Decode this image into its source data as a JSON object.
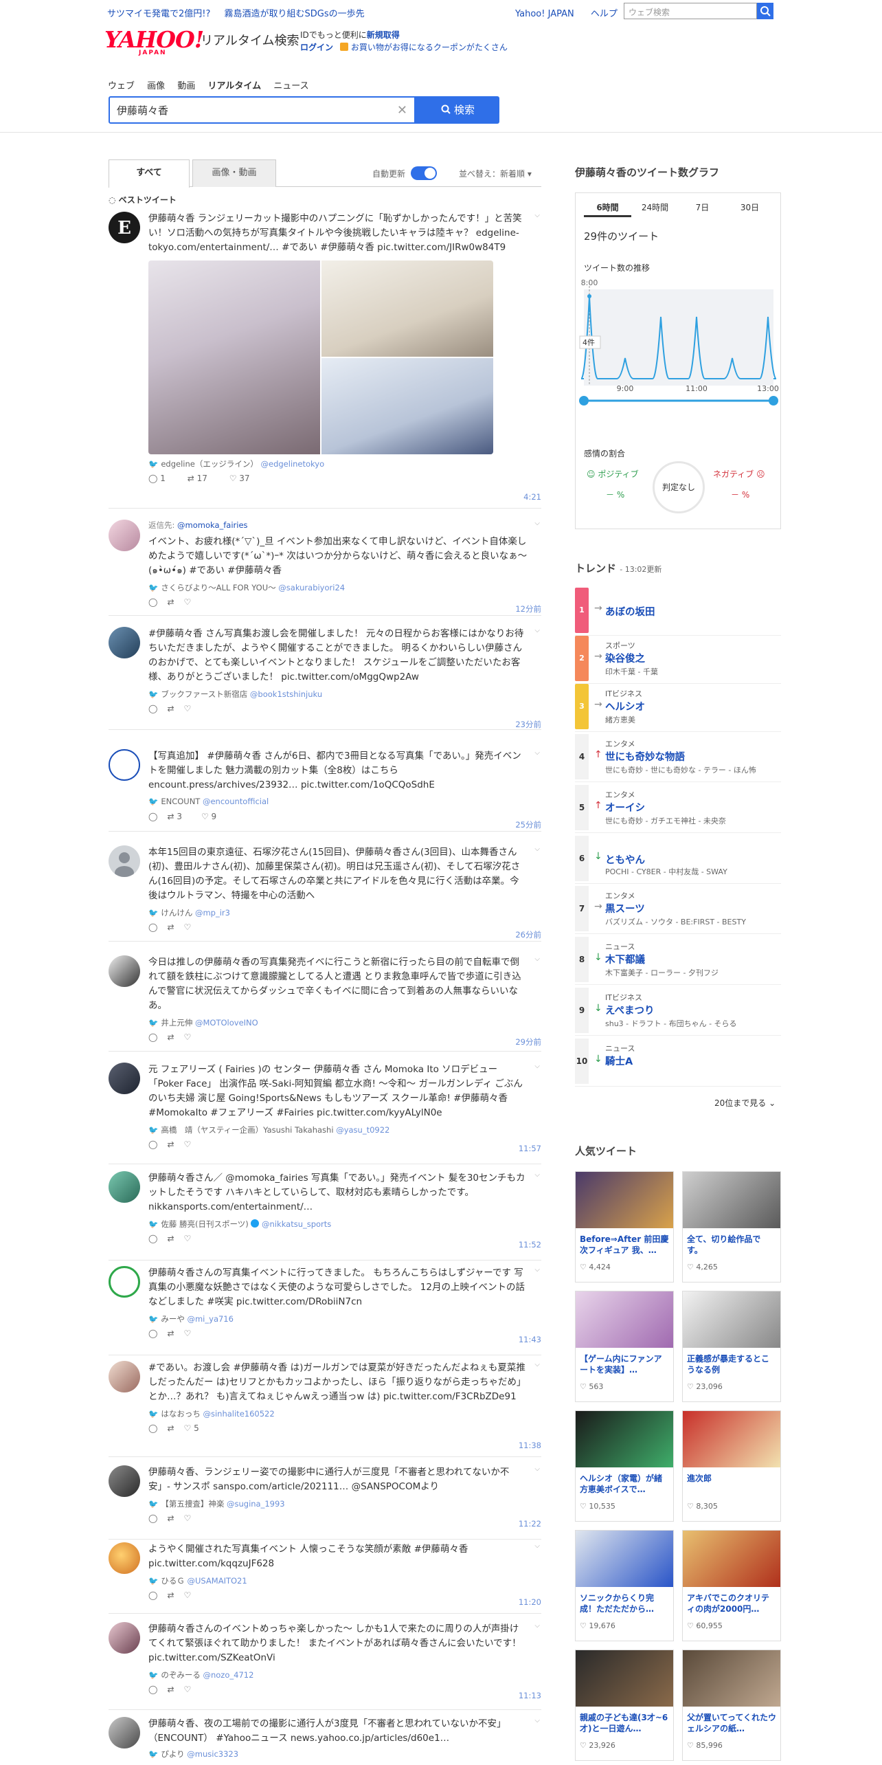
{
  "topstrip": {
    "news": [
      "サツマイモ発電で2億円!?",
      "霧島酒造が取り組むSDGsの一歩先"
    ],
    "links": [
      "Yahoo! JAPAN",
      "ヘルプ"
    ],
    "search_placeholder": "ウェブ検索"
  },
  "header": {
    "logo_text": "YAHOO!",
    "logo_sub": "JAPAN",
    "service": "リアルタイム検索",
    "id_line1a": "IDでもっと便利に",
    "id_line1b": "新規取得",
    "id_line2a": "ログイン",
    "id_line2b": "お買い物がお得になるクーポンがたくさん"
  },
  "nav": [
    "ウェブ",
    "画像",
    "動画",
    "リアルタイム",
    "ニュース"
  ],
  "search": {
    "query": "伊藤萌々香",
    "button": "検索"
  },
  "tabs": {
    "all": "すべて",
    "media": "画像・動画",
    "auto": "自動更新",
    "sort": "並べ替え：新着順"
  },
  "best_header": "ベストツイート",
  "tweets": [
    {
      "text": "伊藤萌々香 ランジェリーカット撮影中のハプニングに「恥ずかしかったんです！」と苦笑い！ソロ活動への気持ちが写真集タイトルや今後挑戦したいキャラは陸キャ？ edgeline-tokyo.com/entertainment/… #であい #伊藤萌々香 pic.twitter.com/JIRw0w84T9",
      "user": "edgeline（エッジライン）",
      "handle": "@edgelinetokyo",
      "reply_count": "1",
      "rt_count": "17",
      "like_count": "37",
      "time": "4:21"
    },
    {
      "reply_to": "@momoka_fairies",
      "text": "イベント、お疲れ様(*´▽`)_旦 イベント参加出来なくて申し訳ないけど、イベント自体楽しめたようで嬉しいです(*´ω`*)ｰ* 次はいつか分からないけど、萌々香に会えると良いなぁ～(๑•̀ω•́๑) #であい #伊藤萌々香",
      "user": "さくらびより～ALL FOR YOU～",
      "handle": "@sakurabiyori24",
      "time": "12分前"
    },
    {
      "text": "#伊藤萌々香 さん写真集お渡し会を開催しました！ 元々の日程からお客様にはかなりお待ちいただきましたが、ようやく開催することができました。 明るくかわいらしい伊藤さんのおかげで、とても楽しいイベントとなりました！ スケジュールをご調整いただいたお客様、ありがとうございました！ pic.twitter.com/oMggQwp2Aw",
      "user": "ブックファースト新宿店",
      "handle": "@book1stshinjuku",
      "time": "23分前"
    },
    {
      "text": "【写真追加】 #伊藤萌々香 さんが6日、都内で3冊目となる写真集「であい。」発売イベントを開催しました 魅力満載の別カット集（全8枚）はこちら encount.press/archives/23932… pic.twitter.com/1oQCQoSdhE",
      "user": "ENCOUNT",
      "handle": "@encountofficial",
      "rt_count": "3",
      "like_count": "9",
      "time": "25分前"
    },
    {
      "text": "本年15回目の東京遠征、石塚汐花さん(15回目)、伊藤萌々香さん(3回目)、山本舞香さん(初)、豊田ルナさん(初)、加藤里保菜さん(初)。明日は兄玉遥さん(初)、そして石塚汐花さん(16回目)の予定。そして石塚さんの卒業と共にアイドルを色々見に行く活動は卒業。今後はウルトラマン、特撮を中心の活動へ",
      "user": "けんけん",
      "handle": "@mp_ir3",
      "time": "26分前"
    },
    {
      "text": "今日は推しの伊藤萌々香の写真集発売イベに行こうと新宿に行ったら目の前で自転車で倒れて額を鉄柱にぶつけて意識朦朧としてる人と遭遇 とりま救急車呼んで皆で歩道に引き込んで警官に状況伝えてからダッシュで辛くもイベに間に合って到着あの人無事ならいいなあ。",
      "user": "井上元伸",
      "handle": "@MOTOloveINO",
      "time": "29分前"
    },
    {
      "text": "元 フェアリーズ ( Fairies )の センター 伊藤萌々香 さん Momoka Ito ソロデビュー「Poker Face」 出演作品 咲-Saki-阿知賀編 都立水商! ～令和～ ガールガンレディ ごぶんのいち夫婦 演じ屋 Going!Sports&News もしもツアーズ スクール革命! #伊藤萌々香 #MomokaIto #フェアリーズ #Fairies pic.twitter.com/kyyALylN0e",
      "user": "高橋　靖（ヤスティー企画）Yasushi Takahashi",
      "handle": "@yasu_t0922",
      "time": "11:57"
    },
    {
      "text": "伊藤萌々香さん／ @momoka_fairies 写真集「であい。」発売イベント 髪を30センチもカットしたそうです ハキハキとしていらして、取材対応も素晴らしかったです。 nikkansports.com/entertainment/…",
      "user": "佐藤 勝亮(日刊スポーツ)",
      "handle": "@nikkatsu_sports",
      "time": "11:52"
    },
    {
      "text": "伊藤萌々香さんの写真集イベントに行ってきました。 もちろんこちらはしずジャーです 写真集の小悪魔な妖艶さではなく天使のような可愛らしさでした。 12月の上映イベントの話などしました #咲実 pic.twitter.com/DRobiiN7cn",
      "user": "みーや",
      "handle": "@mi_ya716",
      "time": "11:43"
    },
    {
      "text": "#であい。お渡し会 #伊藤萌々香 は)ガールガンでは夏菜が好きだったんだよねぇも夏菜推しだったんだー は)セリフとかもカッコよかったし、ほら「振り返りながら走っちゃだめ」とか…？あれ？ も)言えてねぇじゃんwえっ通当っw は) pic.twitter.com/F3CRbZDe91",
      "user": "はなおっち",
      "handle": "@sinhalite160522",
      "like_count": "5",
      "time": "11:38"
    },
    {
      "text": "伊藤萌々香、ランジェリー姿での撮影中に通行人が三度見「不審者と思われてないか不安」- サンスポ sanspo.com/article/202111… @SANSPOCOMより",
      "user": "【第五捜査】神楽",
      "handle": "@sugina_1993",
      "time": "11:22"
    },
    {
      "text": "ようやく開催された写真集イベント 人懐っこそうな笑顔が素敵 #伊藤萌々香 pic.twitter.com/kqqzuJF628",
      "user": "ひるＧ",
      "handle": "@USAMAITO21",
      "time": "11:20"
    },
    {
      "text": "伊藤萌々香さんのイベントめっちゃ楽しかった〜 しかも1人で来たのに周りの人が声掛けてくれて緊張ほぐれて助かりました！ またイベントがあれば萌々香さんに会いたいです！ pic.twitter.com/SZKeatOnVi",
      "user": "のぞみーる",
      "handle": "@nozo_4712",
      "time": "11:13"
    },
    {
      "text": "伊藤萌々香、夜の工場前での撮影に通行人が3度見「不審者と思われていないか不安」（ENCOUNT） #Yahooニュース news.yahoo.co.jp/articles/d60e1…",
      "user": "ぴより",
      "handle": "@music3323",
      "time": ""
    }
  ],
  "graph": {
    "title": "伊藤萌々香のツイート数グラフ",
    "ranges": [
      "6時間",
      "24時間",
      "7日",
      "30日"
    ],
    "count": "29件のツイート",
    "trend_label": "ツイート数の推移",
    "peak_time": "8:00",
    "peak_value": "4件",
    "x_ticks": [
      "9:00",
      "11:00",
      "13:00"
    ],
    "sentiment_label": "感情の割合",
    "positive": "ポジティブ",
    "negative": "ネガティブ",
    "pos_pct": "－ %",
    "neg_pct": "－ %",
    "judge": "判定なし"
  },
  "chart_data": {
    "type": "line",
    "title": "ツイート数の推移",
    "x": [
      "8:00",
      "9:00",
      "10:00",
      "11:00",
      "12:00",
      "13:00"
    ],
    "series": [
      {
        "values": [
          4,
          1,
          3,
          3,
          1,
          3
        ]
      }
    ],
    "peak": {
      "x": "8:00",
      "y": 4
    }
  },
  "trends": {
    "title": "トレンド",
    "updated": "13:02更新",
    "more": "20位まで見る",
    "items": [
      {
        "rank": "1",
        "cat": "",
        "name": "あぼの坂田",
        "rel": "",
        "color": "#f05c7a",
        "dir": "→"
      },
      {
        "rank": "2",
        "cat": "スポーツ",
        "name": "染谷俊之",
        "rel": "印木千葉 - 千葉",
        "color": "#f5885a",
        "dir": "→"
      },
      {
        "rank": "3",
        "cat": "ITビジネス",
        "name": "ヘルシオ",
        "rel": "緒方恵美",
        "color": "#f3c537",
        "dir": "→"
      },
      {
        "rank": "4",
        "cat": "エンタメ",
        "name": "世にも奇妙な物語",
        "rel": "世にも奇妙 - 世にも奇妙な - テラー - ほん怖",
        "dir": "↑"
      },
      {
        "rank": "5",
        "cat": "エンタメ",
        "name": "オーイシ",
        "rel": "世にも奇妙 - ガチエモ神社 - 未央奈",
        "dir": "↑"
      },
      {
        "rank": "6",
        "cat": "",
        "name": "ともやん",
        "rel": "POCHI - CY8ER - 中村友哉 - SWAY",
        "dir": "↓"
      },
      {
        "rank": "7",
        "cat": "エンタメ",
        "name": "黒スーツ",
        "rel": "バズリズム - ソウタ - BE:FIRST - BESTY",
        "dir": "→"
      },
      {
        "rank": "8",
        "cat": "ニュース",
        "name": "木下都議",
        "rel": "木下富美子 - ローラー - 夕刊フジ",
        "dir": "↓"
      },
      {
        "rank": "9",
        "cat": "ITビジネス",
        "name": "えぺまつり",
        "rel": "shu3 - ドラフト - 布団ちゃん - そらる",
        "dir": "↓"
      },
      {
        "rank": "10",
        "cat": "ニュース",
        "name": "騎士A",
        "rel": "",
        "dir": "↓"
      }
    ]
  },
  "popular": {
    "title": "人気ツイート",
    "items": [
      {
        "title": "Before⇒After 前田慶次フィギュア 我、…",
        "likes": "4,424",
        "c1": "#4a3a6a",
        "c2": "#d9a24a"
      },
      {
        "title": "全て、切り絵作品です。",
        "likes": "4,265",
        "c1": "#cfcfcf",
        "c2": "#5a5a5a"
      },
      {
        "title": "【ゲーム内にファンアートを実装】…",
        "likes": "563",
        "c1": "#e8d4ea",
        "c2": "#a06ab0"
      },
      {
        "title": "正義感が暴走するとこうなる例",
        "likes": "23,096",
        "c1": "#f2f2f2",
        "c2": "#888888"
      },
      {
        "title": "ヘルシオ（家電）が緒方恵美ボイスで…",
        "likes": "10,535",
        "c1": "#1a1a1a",
        "c2": "#3fae6a"
      },
      {
        "title": "進次郎",
        "likes": "8,305",
        "c1": "#c8302a",
        "c2": "#f2e2b0"
      },
      {
        "title": "ソニックからくり完成！ただただから…",
        "likes": "19,676",
        "c1": "#e0e6ee",
        "c2": "#2a55c8"
      },
      {
        "title": "アキバでこのクオリティの肉が2000円…",
        "likes": "60,955",
        "c1": "#e8c070",
        "c2": "#b0301c"
      },
      {
        "title": "親戚の子ども達(3才~6才)と一日遊ん…",
        "likes": "23,926",
        "c1": "#2a2a2a",
        "c2": "#8a6a4a"
      },
      {
        "title": "父が置いてってくれたウェルシアの紙…",
        "likes": "85,996",
        "c1": "#5a4a3a",
        "c2": "#c0a890"
      }
    ]
  }
}
